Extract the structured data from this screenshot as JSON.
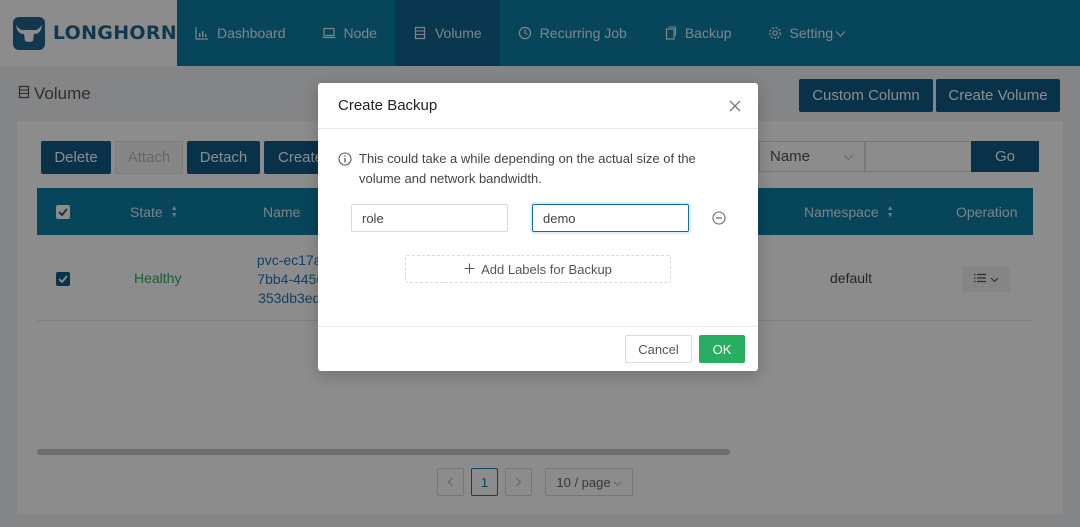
{
  "app": {
    "logo_text": "LONGHORN"
  },
  "nav": {
    "dashboard": "Dashboard",
    "node": "Node",
    "volume": "Volume",
    "recurring_job": "Recurring Job",
    "backup": "Backup",
    "setting": "Setting"
  },
  "page": {
    "title": "Volume",
    "custom_column": "Custom Column",
    "create_volume": "Create Volume"
  },
  "toolbar": {
    "delete": "Delete",
    "attach": "Attach",
    "detach": "Detach",
    "create": "Create",
    "filter_field": "Name",
    "go": "Go"
  },
  "table": {
    "headers": {
      "state": "State",
      "name": "Name",
      "namespace": "Namespace",
      "operation": "Operation"
    },
    "rows": [
      {
        "state": "Healthy",
        "name_lines": [
          "pvc-ec17a7e",
          "7bb4-4456-9",
          "353db3ed43"
        ],
        "namespace": "default"
      }
    ]
  },
  "pagination": {
    "current": "1",
    "page_size": "10 / page"
  },
  "modal": {
    "title": "Create Backup",
    "info": "This could take a while depending on the actual size of the volume and network bandwidth.",
    "label_key": "role",
    "label_value": "demo",
    "add_labels": "Add Labels for Backup",
    "cancel": "Cancel",
    "ok": "OK"
  },
  "colors": {
    "header": "#0e7ea6",
    "primary": "#0f5b85",
    "success": "#27ae60",
    "link": "#1f78b4"
  }
}
